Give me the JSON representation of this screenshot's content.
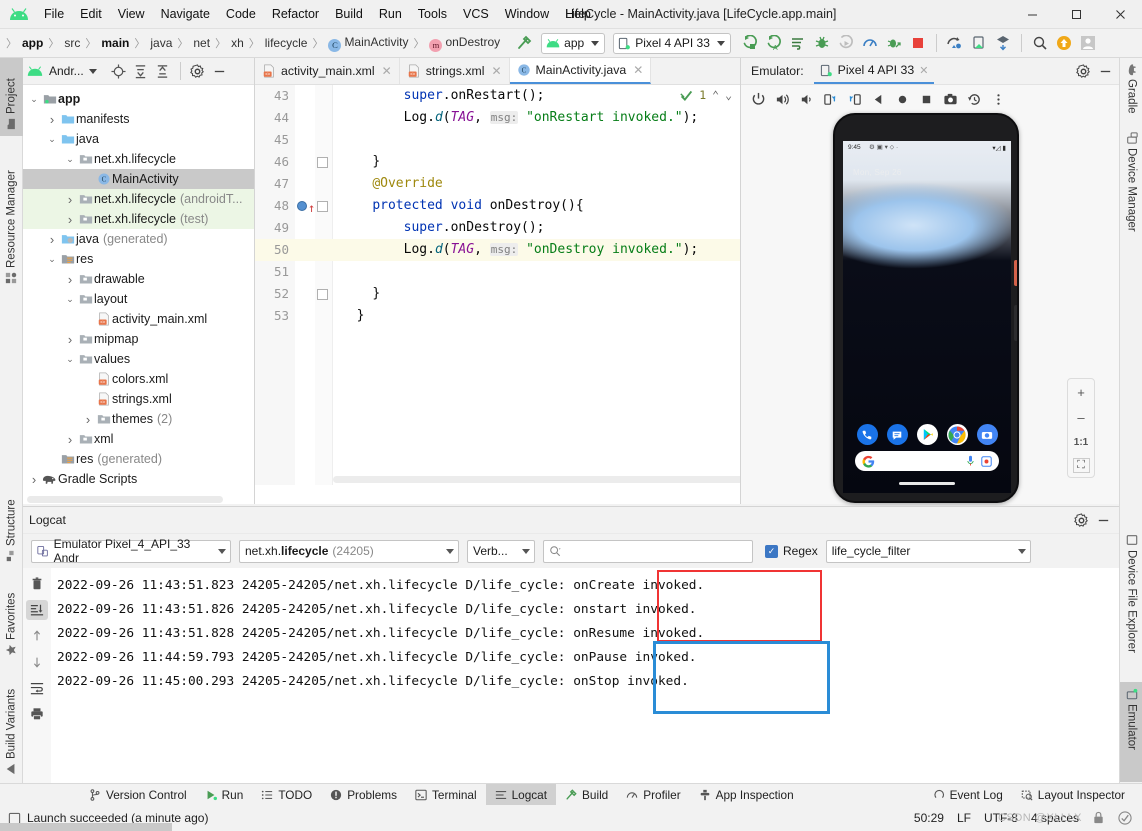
{
  "window": {
    "title": "LifeCycle - MainActivity.java [LifeCycle.app.main]",
    "minimize": "–",
    "maximize": "☐",
    "close": "✕"
  },
  "menubar": {
    "logo_icon": "android-logo-icon",
    "items": [
      "File",
      "Edit",
      "View",
      "Navigate",
      "Code",
      "Refactor",
      "Build",
      "Run",
      "Tools",
      "VCS",
      "Window",
      "Help"
    ]
  },
  "breadcrumb": {
    "leading_sep": "〉",
    "items": [
      {
        "label": "app",
        "bold": true,
        "badge": ""
      },
      {
        "label": "src",
        "bold": false,
        "badge": ""
      },
      {
        "label": "main",
        "bold": true,
        "badge": ""
      },
      {
        "label": "java",
        "bold": false,
        "badge": ""
      },
      {
        "label": "net",
        "bold": false,
        "badge": ""
      },
      {
        "label": "xh",
        "bold": false,
        "badge": ""
      },
      {
        "label": "lifecycle",
        "bold": false,
        "badge": ""
      },
      {
        "label": "MainActivity",
        "bold": false,
        "badge": "C"
      },
      {
        "label": "onDestroy",
        "bold": false,
        "badge": "m"
      }
    ],
    "separator": "〉"
  },
  "toolbar": {
    "build_icon": "hammer-icon",
    "run_config": {
      "label": "app",
      "icon": "android-app-icon"
    },
    "device": {
      "label": "Pixel 4 API 33",
      "icon": "device-icon"
    },
    "actions": [
      {
        "name": "run-icon",
        "glyph": "run"
      },
      {
        "name": "run-coverage-icon",
        "glyph": "runcov"
      },
      {
        "name": "apply-changes-icon",
        "glyph": "applychanges"
      },
      {
        "name": "debug-icon",
        "glyph": "debug"
      },
      {
        "name": "run-disabled-icon",
        "glyph": "rundis"
      },
      {
        "name": "profiler-icon",
        "glyph": "profiler"
      },
      {
        "name": "attach-debugger-icon",
        "glyph": "attach"
      },
      {
        "name": "stop-icon",
        "glyph": "stop"
      },
      {
        "name": "sync-gradle-icon",
        "glyph": "sync"
      },
      {
        "name": "avd-manager-icon",
        "glyph": "avd"
      },
      {
        "name": "sdk-manager-icon",
        "glyph": "sdk"
      },
      {
        "name": "search-everywhere-icon",
        "glyph": "search"
      },
      {
        "name": "update-icon",
        "glyph": "update"
      },
      {
        "name": "account-icon",
        "glyph": "account"
      }
    ]
  },
  "left_tabs": [
    {
      "label": "Project",
      "icon": "project-folder-icon",
      "selected": true
    },
    {
      "label": "Resource Manager",
      "icon": "resource-manager-icon",
      "selected": false
    },
    {
      "label": "Structure",
      "icon": "structure-icon",
      "selected": false
    },
    {
      "label": "Favorites",
      "icon": "star-icon",
      "selected": false
    },
    {
      "label": "Build Variants",
      "icon": "build-variants-icon",
      "selected": false
    }
  ],
  "right_tabs": [
    {
      "label": "Gradle",
      "icon": "gradle-elephant-icon",
      "selected": false
    },
    {
      "label": "Device Manager",
      "icon": "device-manager-icon",
      "selected": false
    },
    {
      "label": "Device File Explorer",
      "icon": "device-file-explorer-icon",
      "selected": false
    },
    {
      "label": "Emulator",
      "icon": "emulator-icon",
      "selected": true
    }
  ],
  "project_panel": {
    "header": {
      "title": "Andr...",
      "icon": "android-view-icon",
      "buttons": [
        "locate-icon",
        "expand-all-icon",
        "collapse-all-icon",
        "gear-icon",
        "hide-icon"
      ]
    },
    "tree": [
      {
        "label": "app",
        "sub": "",
        "depth": 0,
        "arrow": "v",
        "icon": "module-icon",
        "bold": true,
        "state": ""
      },
      {
        "label": "manifests",
        "sub": "",
        "depth": 1,
        "arrow": ">",
        "icon": "folder-icon",
        "bold": false,
        "state": ""
      },
      {
        "label": "java",
        "sub": "",
        "depth": 1,
        "arrow": "v",
        "icon": "folder-icon",
        "bold": false,
        "state": ""
      },
      {
        "label": "net.xh.lifecycle",
        "sub": "",
        "depth": 2,
        "arrow": "v",
        "icon": "package-icon",
        "bold": false,
        "state": ""
      },
      {
        "label": "MainActivity",
        "sub": "",
        "depth": 3,
        "arrow": "",
        "icon": "class-icon",
        "bold": false,
        "state": "selected"
      },
      {
        "label": "net.xh.lifecycle",
        "sub": "(androidT...",
        "depth": 2,
        "arrow": ">",
        "icon": "package-icon",
        "bold": false,
        "state": "green"
      },
      {
        "label": "net.xh.lifecycle",
        "sub": "(test)",
        "depth": 2,
        "arrow": ">",
        "icon": "package-icon",
        "bold": false,
        "state": "green"
      },
      {
        "label": "java",
        "sub": "(generated)",
        "depth": 1,
        "arrow": ">",
        "icon": "folder-generated-icon",
        "bold": false,
        "state": ""
      },
      {
        "label": "res",
        "sub": "",
        "depth": 1,
        "arrow": "v",
        "icon": "res-folder-icon",
        "bold": false,
        "state": ""
      },
      {
        "label": "drawable",
        "sub": "",
        "depth": 2,
        "arrow": ">",
        "icon": "package-icon",
        "bold": false,
        "state": ""
      },
      {
        "label": "layout",
        "sub": "",
        "depth": 2,
        "arrow": "v",
        "icon": "package-icon",
        "bold": false,
        "state": ""
      },
      {
        "label": "activity_main.xml",
        "sub": "",
        "depth": 3,
        "arrow": "",
        "icon": "xml-file-icon",
        "bold": false,
        "state": ""
      },
      {
        "label": "mipmap",
        "sub": "",
        "depth": 2,
        "arrow": ">",
        "icon": "package-icon",
        "bold": false,
        "state": ""
      },
      {
        "label": "values",
        "sub": "",
        "depth": 2,
        "arrow": "v",
        "icon": "package-icon",
        "bold": false,
        "state": ""
      },
      {
        "label": "colors.xml",
        "sub": "",
        "depth": 3,
        "arrow": "",
        "icon": "xml-file-icon",
        "bold": false,
        "state": ""
      },
      {
        "label": "strings.xml",
        "sub": "",
        "depth": 3,
        "arrow": "",
        "icon": "xml-file-icon",
        "bold": false,
        "state": ""
      },
      {
        "label": "themes",
        "sub": "(2)",
        "depth": 3,
        "arrow": ">",
        "icon": "package-icon",
        "bold": false,
        "state": ""
      },
      {
        "label": "xml",
        "sub": "",
        "depth": 2,
        "arrow": ">",
        "icon": "package-icon",
        "bold": false,
        "state": ""
      },
      {
        "label": "res",
        "sub": "(generated)",
        "depth": 1,
        "arrow": "",
        "icon": "res-folder-icon",
        "bold": false,
        "state": ""
      },
      {
        "label": "Gradle Scripts",
        "sub": "",
        "depth": 0,
        "arrow": ">",
        "icon": "gradle-elephant-icon",
        "bold": false,
        "state": ""
      }
    ]
  },
  "editor": {
    "tabs": [
      {
        "label": "activity_main.xml",
        "icon": "xml-file-icon",
        "active": false
      },
      {
        "label": "strings.xml",
        "icon": "xml-file-icon",
        "active": false
      },
      {
        "label": "MainActivity.java",
        "icon": "class-icon",
        "active": true
      }
    ],
    "inspection": {
      "count": "1",
      "icon": "inspection-ok-icon",
      "up": "⌃",
      "down": "⌄"
    },
    "lines": [
      {
        "num": "43",
        "indent": 8,
        "tokens": [
          {
            "t": "super",
            "c": "kw"
          },
          {
            "t": ".onRestart();",
            "c": "plain"
          }
        ],
        "hl": false,
        "fold": false,
        "bp": false
      },
      {
        "num": "44",
        "indent": 8,
        "tokens": [
          {
            "t": "Log",
            "c": "plain"
          },
          {
            "t": ".",
            "c": "plain"
          },
          {
            "t": "d",
            "c": "meth"
          },
          {
            "t": "(",
            "c": "plain"
          },
          {
            "t": "TAG",
            "c": "ital"
          },
          {
            "t": ", ",
            "c": "plain"
          },
          {
            "t": "msg:",
            "c": "param"
          },
          {
            "t": " ",
            "c": "plain"
          },
          {
            "t": "\"onRestart invoked.\"",
            "c": "str"
          },
          {
            "t": ");",
            "c": "plain"
          }
        ],
        "hl": false,
        "fold": false,
        "bp": false
      },
      {
        "num": "45",
        "indent": 0,
        "tokens": [],
        "hl": false,
        "fold": false,
        "bp": false
      },
      {
        "num": "46",
        "indent": 4,
        "tokens": [
          {
            "t": "}",
            "c": "plain"
          }
        ],
        "hl": false,
        "fold": true,
        "bp": false
      },
      {
        "num": "47",
        "indent": 4,
        "tokens": [
          {
            "t": "@Override",
            "c": "ann"
          }
        ],
        "hl": false,
        "fold": false,
        "bp": false
      },
      {
        "num": "48",
        "indent": 4,
        "tokens": [
          {
            "t": "protected",
            "c": "kw"
          },
          {
            "t": " ",
            "c": "plain"
          },
          {
            "t": "void",
            "c": "kw"
          },
          {
            "t": " onDestroy(){",
            "c": "plain"
          }
        ],
        "hl": false,
        "fold": true,
        "bp": true
      },
      {
        "num": "49",
        "indent": 8,
        "tokens": [
          {
            "t": "super",
            "c": "kw"
          },
          {
            "t": ".onDestroy();",
            "c": "plain"
          }
        ],
        "hl": false,
        "fold": false,
        "bp": false
      },
      {
        "num": "50",
        "indent": 8,
        "tokens": [
          {
            "t": "Log",
            "c": "plain"
          },
          {
            "t": ".",
            "c": "plain"
          },
          {
            "t": "d",
            "c": "meth"
          },
          {
            "t": "(",
            "c": "plain"
          },
          {
            "t": "TAG",
            "c": "ital"
          },
          {
            "t": ", ",
            "c": "plain"
          },
          {
            "t": "msg:",
            "c": "param"
          },
          {
            "t": " ",
            "c": "plain"
          },
          {
            "t": "\"onDestroy invoked.\"",
            "c": "str"
          },
          {
            "t": ");",
            "c": "plain"
          }
        ],
        "hl": true,
        "fold": false,
        "bp": false
      },
      {
        "num": "51",
        "indent": 0,
        "tokens": [],
        "hl": false,
        "fold": false,
        "bp": false
      },
      {
        "num": "52",
        "indent": 4,
        "tokens": [
          {
            "t": "}",
            "c": "plain"
          }
        ],
        "hl": false,
        "fold": true,
        "bp": false
      },
      {
        "num": "53",
        "indent": 2,
        "tokens": [
          {
            "t": "}",
            "c": "plain"
          }
        ],
        "hl": false,
        "fold": false,
        "bp": false
      }
    ]
  },
  "emulator": {
    "label": "Emulator:",
    "tab": {
      "label": "Pixel 4 API 33",
      "icon": "device-icon",
      "close": "✕"
    },
    "header_buttons": [
      "gear-icon",
      "hide-icon"
    ],
    "toolbar": [
      {
        "name": "power-icon",
        "glyph": "power"
      },
      {
        "name": "volume-up-icon",
        "glyph": "volup"
      },
      {
        "name": "volume-down-icon",
        "glyph": "voldown"
      },
      {
        "name": "rotate-left-icon",
        "glyph": "rotl"
      },
      {
        "name": "rotate-right-icon",
        "glyph": "rotr"
      },
      {
        "name": "back-icon",
        "glyph": "back"
      },
      {
        "name": "home-icon",
        "glyph": "home"
      },
      {
        "name": "overview-icon",
        "glyph": "overview"
      },
      {
        "name": "screenshot-icon",
        "glyph": "screenshot"
      },
      {
        "name": "history-icon",
        "glyph": "history"
      },
      {
        "name": "more-options-icon",
        "glyph": "more"
      }
    ],
    "device_screen": {
      "status_time": "9:45",
      "status_icons": "⚙ ▣ ▾ ⬦ ·",
      "battery_icons": "▾◿ ▮",
      "date_widget": "Mon, Sep 26",
      "dock_apps": [
        "phone-icon",
        "messages-icon",
        "play-store-icon",
        "chrome-icon",
        "camera-icon"
      ],
      "search_bar": {
        "google_icon": "google-g-icon",
        "mic_icon": "microphone-icon",
        "lens_icon": "google-lens-icon"
      }
    },
    "zoom_controls": [
      {
        "name": "zoom-in-button",
        "label": "+"
      },
      {
        "name": "zoom-out-button",
        "label": "–"
      },
      {
        "name": "zoom-actual-button",
        "label": "1:1"
      },
      {
        "name": "zoom-fit-button",
        "label": "⛶"
      }
    ]
  },
  "logcat": {
    "title": "Logcat",
    "header_buttons": [
      "gear-icon",
      "hide-icon"
    ],
    "device_combo": {
      "value": "Emulator Pixel_4_API_33 Andr",
      "icon": "device-icon"
    },
    "process_combo": {
      "prefix": "net.xh.",
      "bold": "lifecycle",
      "pid": "(24205)"
    },
    "level_combo": {
      "value": "Verb..."
    },
    "search": {
      "placeholder": "",
      "icon": "search-icon"
    },
    "regex": {
      "label": "Regex",
      "checked": true
    },
    "filter_combo": {
      "value": "life_cycle_filter"
    },
    "sidebar_icons": [
      {
        "name": "clear-logcat-icon",
        "glyph": "trash",
        "active": false
      },
      {
        "name": "scroll-to-end-icon",
        "glyph": "scrollend",
        "active": true
      },
      {
        "name": "up-icon",
        "glyph": "up",
        "active": false
      },
      {
        "name": "down-icon",
        "glyph": "down",
        "active": false
      },
      {
        "name": "soft-wrap-icon",
        "glyph": "wrap",
        "active": false
      },
      {
        "name": "print-icon",
        "glyph": "print",
        "active": false
      }
    ],
    "entries": [
      {
        "prefix": "2022-09-26 11:43:51.823 24205-24205/net.xh.lifecycle D/life_cycle: ",
        "message": "onCreate invoked."
      },
      {
        "prefix": "2022-09-26 11:43:51.826 24205-24205/net.xh.lifecycle D/life_cycle: ",
        "message": "onstart invoked."
      },
      {
        "prefix": "2022-09-26 11:43:51.828 24205-24205/net.xh.lifecycle D/life_cycle: ",
        "message": "onResume invoked."
      },
      {
        "prefix": "2022-09-26 11:44:59.793 24205-24205/net.xh.lifecycle D/life_cycle: ",
        "message": "onPause invoked."
      },
      {
        "prefix": "2022-09-26 11:45:00.293 24205-24205/net.xh.lifecycle D/life_cycle: ",
        "message": "onStop invoked."
      }
    ],
    "annotations": {
      "red_box_color": "#f03434",
      "blue_box_color": "#2a8cd6"
    }
  },
  "tool_windows": [
    {
      "label": "Version Control",
      "icon": "branch-icon",
      "selected": false
    },
    {
      "label": "Run",
      "icon": "run-icon",
      "selected": false
    },
    {
      "label": "TODO",
      "icon": "todo-icon",
      "selected": false
    },
    {
      "label": "Problems",
      "icon": "problems-icon",
      "selected": false
    },
    {
      "label": "Terminal",
      "icon": "terminal-icon",
      "selected": false
    },
    {
      "label": "Logcat",
      "icon": "logcat-icon",
      "selected": true
    },
    {
      "label": "Build",
      "icon": "hammer-icon",
      "selected": false
    },
    {
      "label": "Profiler",
      "icon": "profiler-icon",
      "selected": false
    },
    {
      "label": "App Inspection",
      "icon": "app-inspection-icon",
      "selected": false
    }
  ],
  "tool_windows_right": [
    {
      "label": "Event Log",
      "icon": "event-log-icon"
    },
    {
      "label": "Layout Inspector",
      "icon": "layout-inspector-icon"
    }
  ],
  "status_bar": {
    "message": "Launch succeeded (a minute ago)",
    "message_icon": "toolwindow-icon",
    "caret": "50:29",
    "line_sep": "LF",
    "encoding": "UTF-8",
    "indent": "4 spaces",
    "lock_icon": "lock-icon",
    "inspection_icon": "inspection-icon",
    "watermark": "CSDN @XLLLX"
  }
}
